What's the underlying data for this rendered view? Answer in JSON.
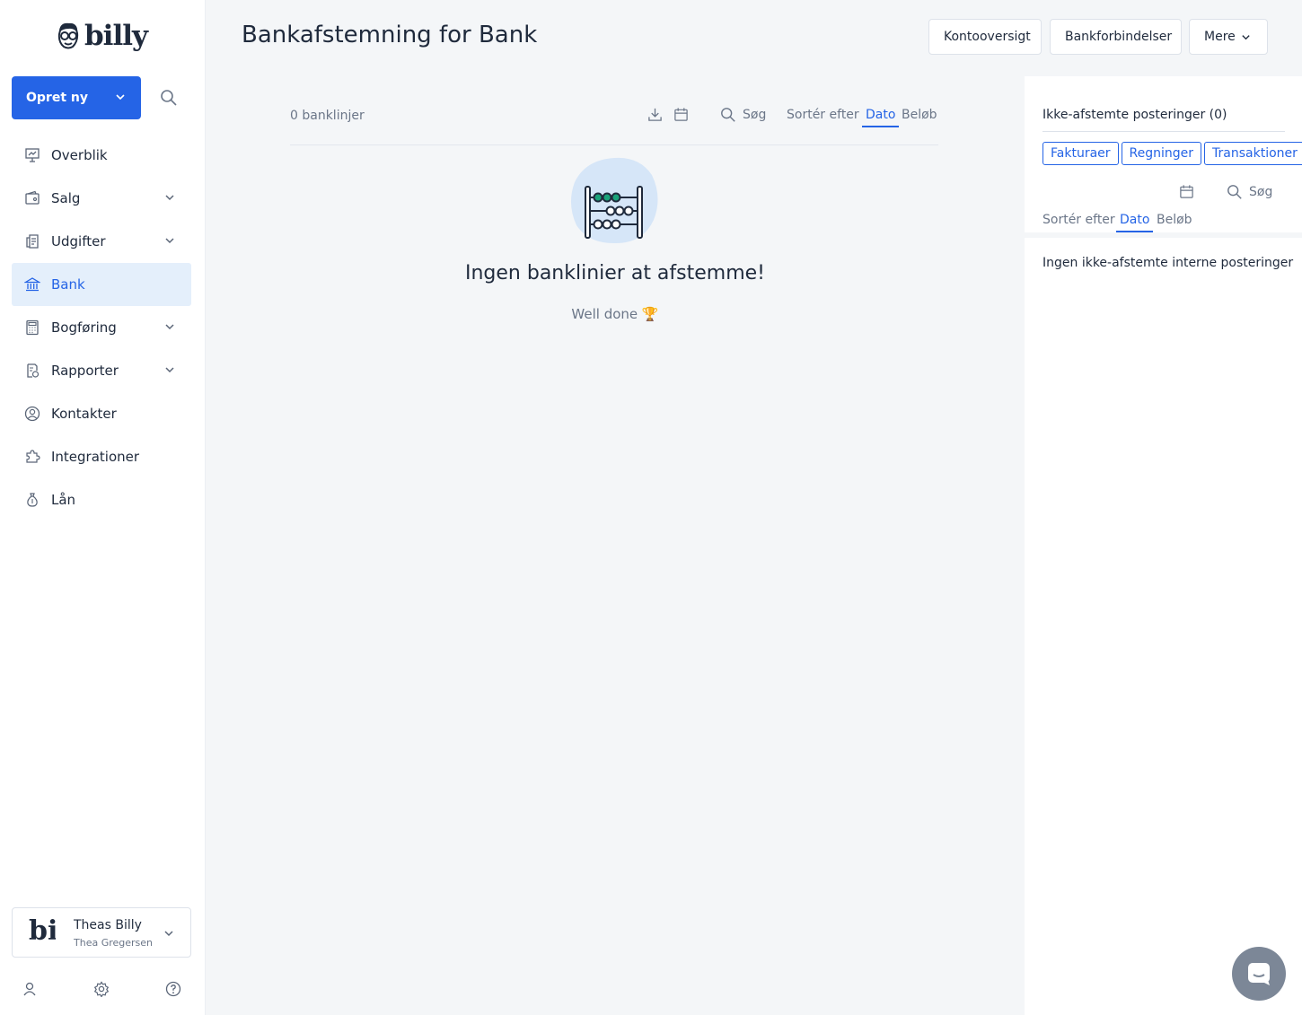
{
  "app": {
    "logo_text": "billy"
  },
  "sidebar": {
    "create_label": "Opret ny",
    "items": [
      {
        "label": "Overblik",
        "icon": "presentation-icon",
        "has_submenu": false
      },
      {
        "label": "Salg",
        "icon": "wallet-icon",
        "has_submenu": true
      },
      {
        "label": "Udgifter",
        "icon": "receipt-icon",
        "has_submenu": true
      },
      {
        "label": "Bank",
        "icon": "bank-icon",
        "has_submenu": false,
        "active": true
      },
      {
        "label": "Bogføring",
        "icon": "calculator-icon",
        "has_submenu": true
      },
      {
        "label": "Rapporter",
        "icon": "report-icon",
        "has_submenu": true
      },
      {
        "label": "Kontakter",
        "icon": "user-circle-icon",
        "has_submenu": false
      },
      {
        "label": "Integrationer",
        "icon": "puzzle-icon",
        "has_submenu": false
      },
      {
        "label": "Lån",
        "icon": "money-bag-icon",
        "has_submenu": false
      }
    ],
    "org": {
      "logo_text": "bil",
      "name": "Theas Billy",
      "user": "Thea Gregersen"
    }
  },
  "header": {
    "title": "Bankafstemning for Bank",
    "buttons": {
      "accounts": "Kontooversigt",
      "connections": "Bankforbindelser",
      "more": "Mere"
    }
  },
  "list": {
    "count_label": "0 banklinjer",
    "search_label": "Søg",
    "sort_label": "Sortér efter",
    "sort_date": "Dato",
    "sort_amount": "Beløb",
    "empty_title": "Ingen banklinier at afstemme!",
    "empty_subtitle": "Well done 🏆"
  },
  "right_panel": {
    "title": "Ikke-afstemte posteringer (0)",
    "tabs": [
      "Fakturaer",
      "Regninger",
      "Transaktioner"
    ],
    "search_label": "Søg",
    "sort_label": "Sortér efter",
    "sort_date": "Dato",
    "sort_amount": "Beløb",
    "empty_text": "Ingen ikke-afstemte interne posteringer"
  },
  "colors": {
    "accent": "#2564e6",
    "active_bg": "#e4effb",
    "abacus_green": "#1aa37a"
  }
}
